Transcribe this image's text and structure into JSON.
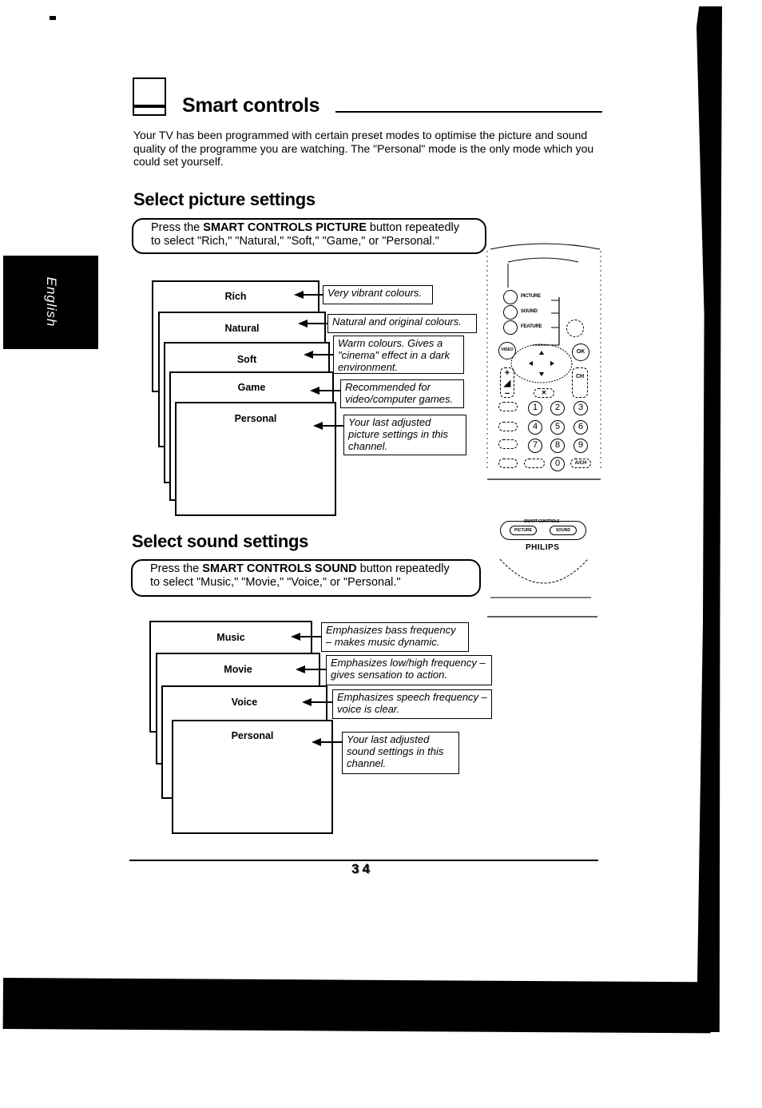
{
  "page": {
    "side_tab": "English",
    "page_number": "34"
  },
  "header": {
    "title": "Smart controls",
    "icon": "tv-icon",
    "intro": "Your TV has been programmed with certain preset modes to optimise the picture and sound quality of the programme you are watching. The \"Personal\" mode is the only mode which you could set yourself."
  },
  "picture": {
    "heading": "Select picture settings",
    "instruction_prefix": "Press the ",
    "instruction_button": "SMART CONTROLS PICTURE",
    "instruction_suffix": " button repeatedly",
    "instruction_line2": "to select \"Rich,\" \"Natural,\" \"Soft,\" \"Game,\" or \"Personal.\"",
    "modes": [
      {
        "label": "Rich",
        "desc": "Very vibrant colours."
      },
      {
        "label": "Natural",
        "desc": "Natural and original colours."
      },
      {
        "label": "Soft",
        "desc": "Warm colours.  Gives a \"cinema\" effect in a dark environment."
      },
      {
        "label": "Game",
        "desc": "Recommended for video/computer games."
      },
      {
        "label": "Personal",
        "desc": "Your last adjusted picture settings in this channel."
      }
    ]
  },
  "sound": {
    "heading": "Select sound settings",
    "instruction_prefix": "Press the ",
    "instruction_button": "SMART CONTROLS SOUND",
    "instruction_suffix": " button repeatedly",
    "instruction_line2": "to select \"Music,\" \"Movie,\" \"Voice,\" or \"Personal.\"",
    "modes": [
      {
        "label": "Music",
        "desc": "Emphasizes bass frequency – makes music dynamic."
      },
      {
        "label": "Movie",
        "desc": "Emphasizes low/high frequency – gives sensation to action."
      },
      {
        "label": "Voice",
        "desc": "Emphasizes speech frequency – voice is clear."
      },
      {
        "label": "Personal",
        "desc": "Your last adjusted sound settings in this channel."
      }
    ]
  },
  "remote": {
    "side_buttons": [
      "PICTURE",
      "SOUND",
      "FEATURE"
    ],
    "video_button": "VIDEO",
    "ok_button": "OK",
    "ch_label": "CH",
    "numbers": [
      "1",
      "2",
      "3",
      "4",
      "5",
      "6",
      "7",
      "8",
      "9",
      "0"
    ],
    "ach_button": "A/CH",
    "smart_controls_label": "SMART CONTROLS",
    "smart_picture": "PICTURE",
    "smart_sound": "SOUND",
    "brand": "PHILIPS"
  }
}
